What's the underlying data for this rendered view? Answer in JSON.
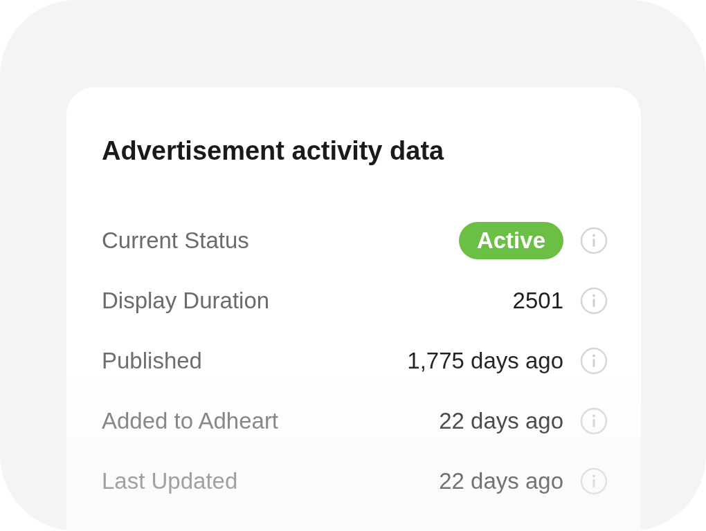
{
  "card": {
    "title": "Advertisement activity data",
    "rows": [
      {
        "label": "Current Status",
        "value": "Active",
        "kind": "badge"
      },
      {
        "label": "Display Duration",
        "value": "2501",
        "kind": "text"
      },
      {
        "label": "Published",
        "value": "1,775 days ago",
        "kind": "text"
      },
      {
        "label": "Added to Adheart",
        "value": "22 days ago",
        "kind": "text"
      },
      {
        "label": "Last Updated",
        "value": "22 days ago",
        "kind": "text"
      }
    ]
  }
}
